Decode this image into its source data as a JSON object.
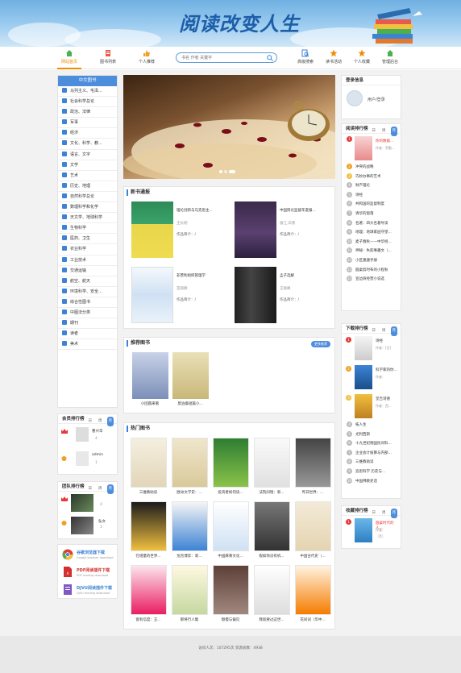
{
  "banner": {
    "title": "阅读改变人生"
  },
  "nav": {
    "items": [
      {
        "label": "网站首页",
        "icon": "home-icon",
        "color": "#4caf50",
        "active": true
      },
      {
        "label": "图书列表",
        "icon": "list-icon",
        "color": "#e85b4b"
      },
      {
        "label": "个人推荐",
        "icon": "thumb-up-icon",
        "color": "#f0a020"
      },
      {
        "label": "高级搜索",
        "icon": "search-doc-icon",
        "color": "#3d83d5"
      },
      {
        "label": "读书活动",
        "icon": "star-icon",
        "color": "#f08c00"
      },
      {
        "label": "个人收藏",
        "icon": "star-icon",
        "color": "#f08c00"
      },
      {
        "label": "管理后台",
        "icon": "home-icon",
        "color": "#4caf50"
      }
    ]
  },
  "search": {
    "placeholder": "书名 作者 关键字"
  },
  "categories": {
    "title": "中文图书",
    "items": [
      "马列主义、毛泽...",
      "社会科学总论",
      "政治、法律",
      "军事",
      "经济",
      "文化、科学、教...",
      "语言、文字",
      "文学",
      "艺术",
      "历史、地理",
      "自然科学总论",
      "数理科学和化学",
      "天文学、地球科学",
      "生物科学",
      "医药、卫生",
      "农业科学",
      "工业技术",
      "交通运输",
      "航空、航天",
      "环境科学、安全...",
      "综合性图书",
      "中图法分类",
      "期刊",
      "读者",
      "美术"
    ]
  },
  "member_rank": {
    "title": "会员排行榜",
    "tab_day": "日",
    "tab_week": "周",
    "tab_month": "月",
    "users": [
      {
        "name": "曹兴华",
        "count": "4"
      },
      {
        "name": "admin",
        "count": "1"
      }
    ]
  },
  "team_rank": {
    "title": "团队排行榜",
    "tab_day": "日",
    "tab_week": "周",
    "tab_month": "月",
    "teams": [
      {
        "name": "",
        "count": "4"
      },
      {
        "name": "弘文",
        "count": "1"
      }
    ]
  },
  "downloads": [
    {
      "title": "谷歌浏览器下载",
      "sub": "Google browser download"
    },
    {
      "title": "PDF阅读插件下载",
      "sub": "PDF reading download"
    },
    {
      "title": "DJVU阅读插件下载",
      "sub": "DJVU reading download"
    }
  ],
  "new_books": {
    "title": "新书通报",
    "books": [
      {
        "title": "理论创新与马克思主...",
        "author": "王长刚",
        "desc": "作品简介：/"
      },
      {
        "title": "中国舆论监督年度报...",
        "author": "展江,白勇",
        "desc": "作品简介：/"
      },
      {
        "title": "非营利组织管理学",
        "author": "苗丽静",
        "desc": "作品简介：/"
      },
      {
        "title": "孟子选解",
        "author": "王岷峰",
        "desc": "作品简介：/"
      }
    ]
  },
  "recommended": {
    "title": "推荐图书",
    "more": "更多推荐",
    "books": [
      "小团圆来看",
      "莫泊桑短篇小..."
    ]
  },
  "hot_books": {
    "title": "热门图书",
    "books": [
      "三维教助读",
      "欧洲文学史：...",
      "投资者如何读...",
      "法院间钱：新...",
      "昨日世界：...",
      "在增量的世界...",
      "危险博弈：新...",
      "中国麻黄文化...",
      "假如你没有机...",
      "中国古代史（...",
      "窗有信度：王...",
      "那将行人集",
      "傲慢与偏见",
      "我就要过这世...",
      "花间词（华中..."
    ]
  },
  "login": {
    "title": "登录信息",
    "text": "用户/登录"
  },
  "read_rank": {
    "title": "阅读排行榜",
    "tab_day": "日",
    "tab_week": "周",
    "tab_month": "月",
    "top": {
      "title": "你的数据...",
      "author": "作者：贺勤..."
    },
    "items": [
      "冲突的战略",
      "巧妙办事的艺术",
      "财产理论",
      "诗经",
      "共和国的监督制度",
      "清华的窗落",
      "名著：四大名著导读",
      "地理：地球家园守望...",
      "麦子春秋——中华经...",
      "神秘：失踪事趣文（...",
      "小区邋邋手册",
      "圆桌剪时布的小程秋",
      "宣边商经营小说选"
    ]
  },
  "download_rank": {
    "title": "下载排行榜",
    "tab_day": "日",
    "tab_week": "周",
    "tab_month": "月",
    "top": [
      {
        "title": "诗经",
        "author": "作者：[古]"
      },
      {
        "title": "科学家的你...",
        "author": "作者："
      },
      {
        "title": "堂吉诃德",
        "author": "作者：西..."
      }
    ],
    "items": [
      "拓人生",
      "尤利西斯",
      "十九世纪德国民间科...",
      "企业会计核算与内部...",
      "三维教助读",
      "追思科学 历史与...",
      "中国佛教史话"
    ]
  },
  "fav_rank": {
    "title": "收藏排行榜",
    "tab_day": "日",
    "tab_week": "周",
    "tab_month": "月",
    "top": {
      "title": "圆桌时代的人...",
      "author": "作者："
    },
    "cn": "（苹）"
  },
  "footer": {
    "text": "访问人次：107295次  资源总数：4938"
  },
  "colors": {
    "accent": "#3d83d5",
    "orange": "#f08c00",
    "bg": "#f2f2f2"
  }
}
